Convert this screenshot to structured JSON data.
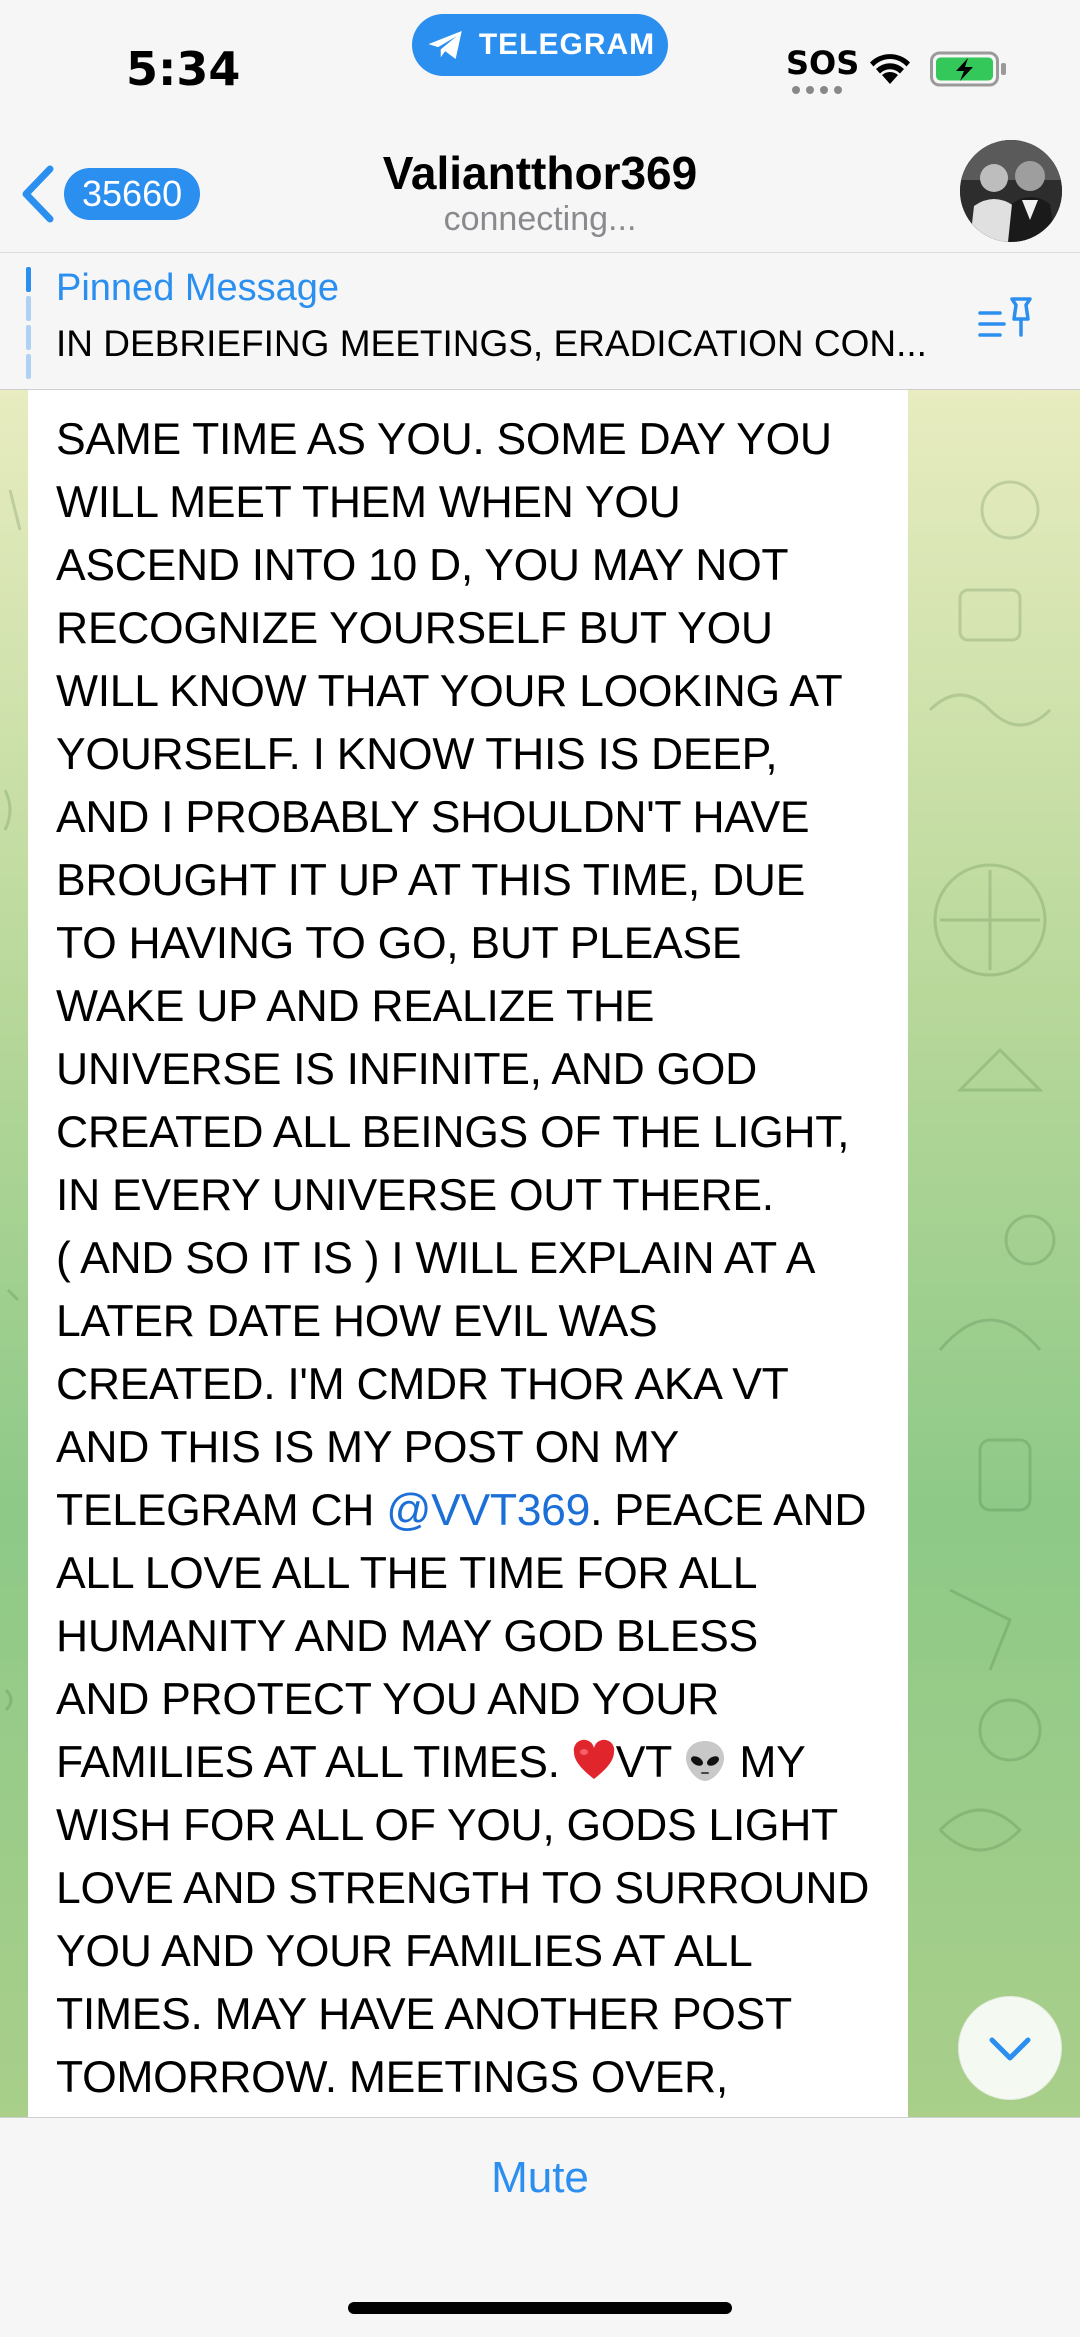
{
  "status_bar": {
    "time": "5:34",
    "app_pill": "TELEGRAM",
    "sos": "SOS",
    "icons": [
      "telegram-icon",
      "wifi-icon",
      "battery-charging-icon"
    ]
  },
  "header": {
    "unread_count": "35660",
    "title": "Valiantthor369",
    "subtitle": "connecting..."
  },
  "pinned": {
    "label": "Pinned Message",
    "text": "IN DEBRIEFING MEETINGS, ERADICATION CON..."
  },
  "message": {
    "lines": [
      "SAME TIME AS YOU. SOME DAY YOU",
      "WILL MEET THEM WHEN YOU",
      "ASCEND INTO 10 D, YOU MAY NOT",
      "RECOGNIZE YOURSELF BUT YOU",
      "WILL KNOW THAT YOUR LOOKING AT",
      "YOURSELF. I KNOW THIS IS DEEP,",
      "AND I PROBABLY SHOULDN'T HAVE",
      "BROUGHT IT UP AT THIS TIME, DUE",
      "TO HAVING TO GO, BUT PLEASE",
      "WAKE UP AND REALIZE THE",
      "UNIVERSE IS INFINITE, AND GOD",
      "CREATED ALL BEINGS OF THE LIGHT,",
      "IN EVERY UNIVERSE OUT THERE.",
      "( AND SO IT IS ) I WILL EXPLAIN AT A",
      "LATER DATE HOW EVIL WAS",
      "CREATED. I'M CMDR THOR AKA VT",
      "AND THIS IS MY POST ON MY"
    ],
    "line_mention_before": "TELEGRAM CH ",
    "mention": "@VVT369",
    "line_mention_after": ". PEACE AND",
    "lines_2": [
      "ALL LOVE ALL THE TIME FOR ALL",
      "HUMANITY AND MAY GOD BLESS",
      "AND PROTECT YOU AND YOUR"
    ],
    "line_emoji_before": "FAMILIES AT ALL TIMES. ",
    "line_emoji_mid": "VT ",
    "line_emoji_after": " MY",
    "emojis": [
      "red-heart-emoji",
      "alien-emoji"
    ],
    "lines_3": [
      "WISH FOR ALL OF YOU, GODS LIGHT",
      "LOVE AND STRENGTH TO SURROUND",
      "YOU AND YOUR FAMILIES AT ALL",
      "TIMES. MAY HAVE ANOTHER POST",
      "TOMORROW. MEETINGS OVER,",
      "GOING BACK DOWN TO JOIN MY"
    ]
  },
  "footer": {
    "mute_label": "Mute"
  },
  "colors": {
    "accent": "#2b8ff0",
    "mention": "#1c6fd6",
    "wallpaper_top": "#e8ecc0",
    "wallpaper_bottom": "#8ec988"
  }
}
